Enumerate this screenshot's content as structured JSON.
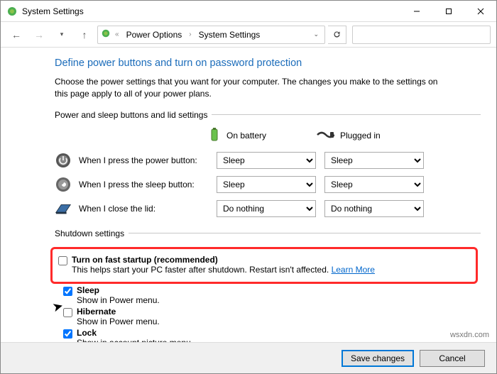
{
  "window": {
    "title": "System Settings"
  },
  "nav": {
    "crumb1": "Power Options",
    "crumb2": "System Settings",
    "search_ph": ""
  },
  "heading": "Define power buttons and turn on password protection",
  "description": "Choose the power settings that you want for your computer. The changes you make to the settings on this page apply to all of your power plans.",
  "fieldset1_legend": "Power and sleep buttons and lid settings",
  "cols": {
    "battery": "On battery",
    "plugged": "Plugged in"
  },
  "rows": {
    "power": {
      "label": "When I press the power button:",
      "battery_val": "Sleep",
      "plugged_val": "Sleep"
    },
    "sleep": {
      "label": "When I press the sleep button:",
      "battery_val": "Sleep",
      "plugged_val": "Sleep"
    },
    "lid": {
      "label": "When I close the lid:",
      "battery_val": "Do nothing",
      "plugged_val": "Do nothing"
    }
  },
  "fieldset2_legend": "Shutdown settings",
  "opts": {
    "fast": {
      "title": "Turn on fast startup (recommended)",
      "sub": "This helps start your PC faster after shutdown. Restart isn't affected.",
      "link": "Learn More",
      "checked": false
    },
    "slp": {
      "title": "Sleep",
      "sub": "Show in Power menu.",
      "checked": true
    },
    "hib": {
      "title": "Hibernate",
      "sub": "Show in Power menu.",
      "checked": false
    },
    "lock": {
      "title": "Lock",
      "sub": "Show in account picture menu.",
      "checked": true
    }
  },
  "footer": {
    "save": "Save changes",
    "cancel": "Cancel"
  },
  "watermark": "wsxdn.com"
}
